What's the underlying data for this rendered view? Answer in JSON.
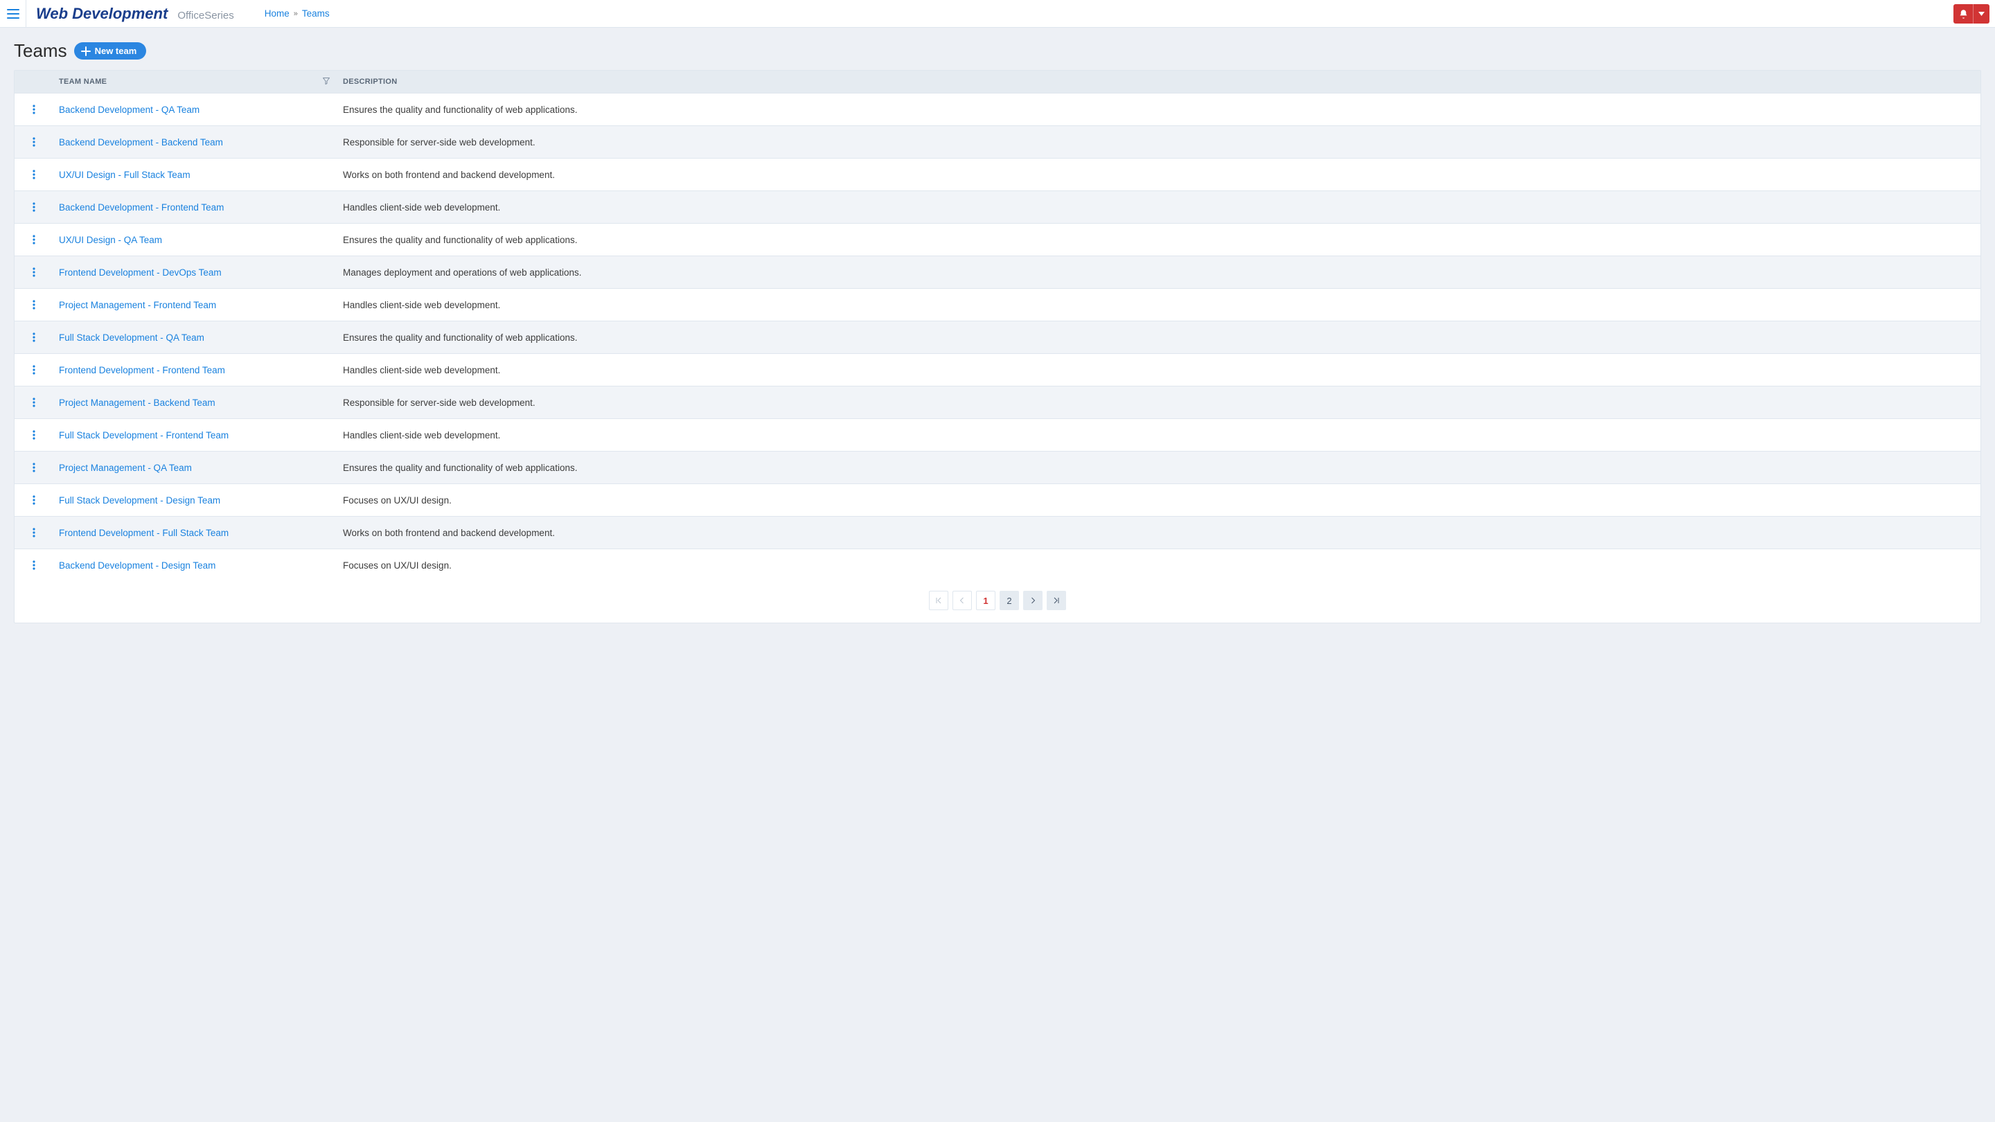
{
  "brand": {
    "title": "Web Development",
    "sub": "OfficeSeries"
  },
  "breadcrumbs": {
    "home": "Home",
    "current": "Teams"
  },
  "page": {
    "title": "Teams",
    "new_button": "New team"
  },
  "table": {
    "columns": {
      "name": "Team Name",
      "description": "Description"
    },
    "rows": [
      {
        "name": "Backend Development - QA Team",
        "description": "Ensures the quality and functionality of web applications."
      },
      {
        "name": "Backend Development - Backend Team",
        "description": "Responsible for server-side web development."
      },
      {
        "name": "UX/UI Design - Full Stack Team",
        "description": "Works on both frontend and backend development."
      },
      {
        "name": "Backend Development - Frontend Team",
        "description": "Handles client-side web development."
      },
      {
        "name": "UX/UI Design - QA Team",
        "description": "Ensures the quality and functionality of web applications."
      },
      {
        "name": "Frontend Development - DevOps Team",
        "description": "Manages deployment and operations of web applications."
      },
      {
        "name": "Project Management - Frontend Team",
        "description": "Handles client-side web development."
      },
      {
        "name": "Full Stack Development - QA Team",
        "description": "Ensures the quality and functionality of web applications."
      },
      {
        "name": "Frontend Development - Frontend Team",
        "description": "Handles client-side web development."
      },
      {
        "name": "Project Management - Backend Team",
        "description": "Responsible for server-side web development."
      },
      {
        "name": "Full Stack Development - Frontend Team",
        "description": "Handles client-side web development."
      },
      {
        "name": "Project Management - QA Team",
        "description": "Ensures the quality and functionality of web applications."
      },
      {
        "name": "Full Stack Development - Design Team",
        "description": "Focuses on UX/UI design."
      },
      {
        "name": "Frontend Development - Full Stack Team",
        "description": "Works on both frontend and backend development."
      },
      {
        "name": "Backend Development - Design Team",
        "description": "Focuses on UX/UI design."
      }
    ]
  },
  "pagination": {
    "pages": [
      "1",
      "2"
    ],
    "current": "1"
  }
}
